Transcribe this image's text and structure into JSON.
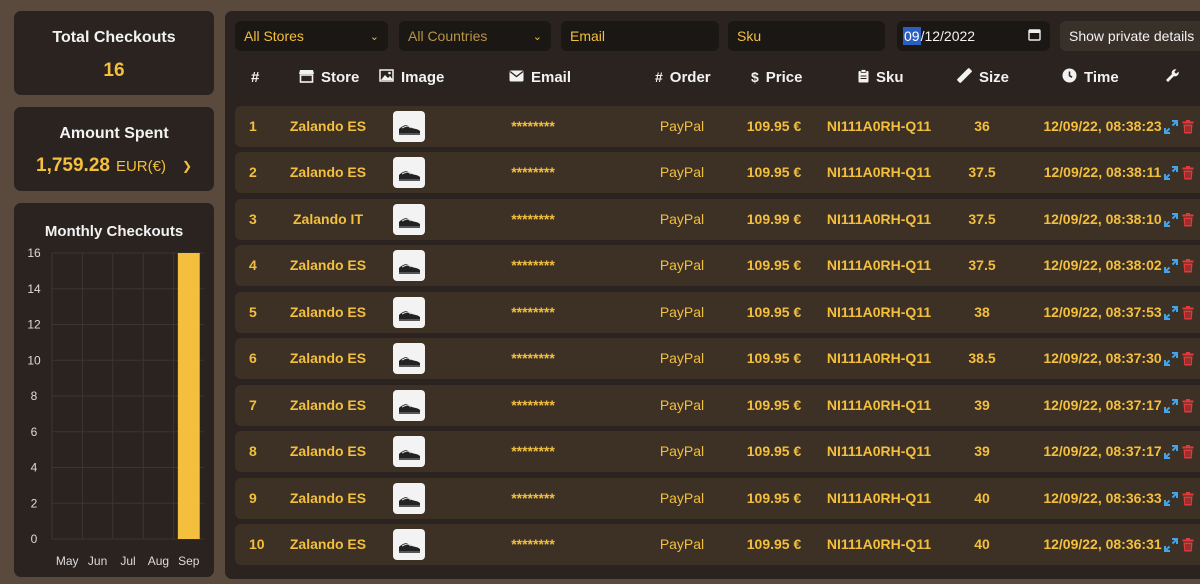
{
  "stats": {
    "total_title": "Total Checkouts",
    "total_value": "16",
    "spent_title": "Amount Spent",
    "spent_amount": "1,759.28",
    "spent_currency": "EUR(€)"
  },
  "chart_data": {
    "type": "bar",
    "title": "Monthly Checkouts",
    "categories": [
      "May",
      "Jun",
      "Jul",
      "Aug",
      "Sep"
    ],
    "values": [
      0,
      0,
      0,
      0,
      16
    ],
    "ylim": [
      0,
      16
    ],
    "yticks": [
      "0",
      "2",
      "4",
      "6",
      "8",
      "10",
      "12",
      "14",
      "16"
    ],
    "grid": true,
    "bar_color": "#f3bf3d"
  },
  "filters": {
    "stores": "All Stores",
    "countries": "All Countries",
    "email_placeholder": "Email",
    "sku_placeholder": "Sku",
    "date_selected": "09",
    "date_rest": "/12/2022",
    "private_label": "Show private details"
  },
  "columns": {
    "num": "#",
    "store": "Store",
    "image": "Image",
    "email": "Email",
    "order": "Order",
    "price": "Price",
    "sku": "Sku",
    "size": "Size",
    "time": "Time"
  },
  "rows": [
    {
      "num": "1",
      "store": "Zalando ES",
      "email": "********",
      "order": "PayPal",
      "price": "109.95 €",
      "sku": "NI111A0RH-Q11",
      "size": "36",
      "time": "12/09/22, 08:38:23"
    },
    {
      "num": "2",
      "store": "Zalando ES",
      "email": "********",
      "order": "PayPal",
      "price": "109.95 €",
      "sku": "NI111A0RH-Q11",
      "size": "37.5",
      "time": "12/09/22, 08:38:11"
    },
    {
      "num": "3",
      "store": "Zalando IT",
      "email": "********",
      "order": "PayPal",
      "price": "109.99 €",
      "sku": "NI111A0RH-Q11",
      "size": "37.5",
      "time": "12/09/22, 08:38:10"
    },
    {
      "num": "4",
      "store": "Zalando ES",
      "email": "********",
      "order": "PayPal",
      "price": "109.95 €",
      "sku": "NI111A0RH-Q11",
      "size": "37.5",
      "time": "12/09/22, 08:38:02"
    },
    {
      "num": "5",
      "store": "Zalando ES",
      "email": "********",
      "order": "PayPal",
      "price": "109.95 €",
      "sku": "NI111A0RH-Q11",
      "size": "38",
      "time": "12/09/22, 08:37:53"
    },
    {
      "num": "6",
      "store": "Zalando ES",
      "email": "********",
      "order": "PayPal",
      "price": "109.95 €",
      "sku": "NI111A0RH-Q11",
      "size": "38.5",
      "time": "12/09/22, 08:37:30"
    },
    {
      "num": "7",
      "store": "Zalando ES",
      "email": "********",
      "order": "PayPal",
      "price": "109.95 €",
      "sku": "NI111A0RH-Q11",
      "size": "39",
      "time": "12/09/22, 08:37:17"
    },
    {
      "num": "8",
      "store": "Zalando ES",
      "email": "********",
      "order": "PayPal",
      "price": "109.95 €",
      "sku": "NI111A0RH-Q11",
      "size": "39",
      "time": "12/09/22, 08:37:17"
    },
    {
      "num": "9",
      "store": "Zalando ES",
      "email": "********",
      "order": "PayPal",
      "price": "109.95 €",
      "sku": "NI111A0RH-Q11",
      "size": "40",
      "time": "12/09/22, 08:36:33"
    },
    {
      "num": "10",
      "store": "Zalando ES",
      "email": "********",
      "order": "PayPal",
      "price": "109.95 €",
      "sku": "NI111A0RH-Q11",
      "size": "40",
      "time": "12/09/22, 08:36:31"
    }
  ],
  "icons": {
    "store": "store-icon",
    "image": "image-icon",
    "email": "envelope-icon",
    "order": "hash-icon",
    "price": "dollar-icon",
    "sku": "clipboard-icon",
    "size": "ruler-icon",
    "time": "clock-icon",
    "actions": "wrench-icon",
    "expand": "expand-icon",
    "delete": "trash-icon"
  },
  "colors": {
    "accent": "#f3bf3d",
    "panel": "#2a2320",
    "row": "#3d3126",
    "expand": "#43a4ea",
    "delete": "#e23a3a"
  }
}
